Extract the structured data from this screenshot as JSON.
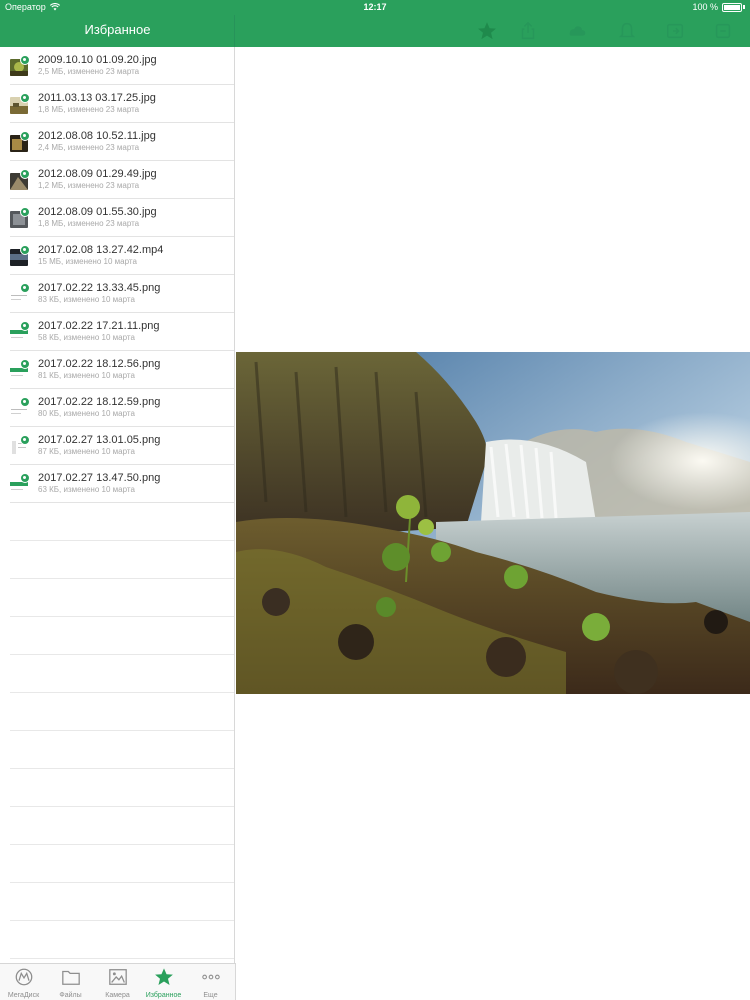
{
  "status_bar": {
    "carrier": "Оператор",
    "time": "12:17",
    "battery": "100 %"
  },
  "nav": {
    "title": "Избранное"
  },
  "toolbar": {
    "icons": [
      "star-icon",
      "share-icon",
      "link-icon",
      "delete-icon",
      "folder-move-icon",
      "more-icon"
    ]
  },
  "files": [
    {
      "name": "2009.10.10 01.09.20.jpg",
      "meta": "2,5 МБ, изменено 23 марта",
      "kind": "photo-green"
    },
    {
      "name": "2011.03.13 03.17.25.jpg",
      "meta": "1,8 МБ, изменено 23 марта",
      "kind": "photo-field"
    },
    {
      "name": "2012.08.08 10.52.11.jpg",
      "meta": "2,4 МБ, изменено 23 марта",
      "kind": "photo-dark"
    },
    {
      "name": "2012.08.09 01.29.49.jpg",
      "meta": "1,2 МБ, изменено 23 марта",
      "kind": "photo-rock"
    },
    {
      "name": "2012.08.09 01.55.30.jpg",
      "meta": "1,8 МБ, изменено 23 марта",
      "kind": "photo-grey"
    },
    {
      "name": "2017.02.08 13.27.42.mp4",
      "meta": "15 МБ, изменено 10 марта",
      "kind": "video"
    },
    {
      "name": "2017.02.22 13.33.45.png",
      "meta": "83 КБ, изменено 10 марта",
      "kind": "screen"
    },
    {
      "name": "2017.02.22 17.21.11.png",
      "meta": "58 КБ, изменено 10 марта",
      "kind": "screen-green"
    },
    {
      "name": "2017.02.22 18.12.56.png",
      "meta": "81 КБ, изменено 10 марта",
      "kind": "screen-green"
    },
    {
      "name": "2017.02.22 18.12.59.png",
      "meta": "80 КБ, изменено 10 марта",
      "kind": "screen"
    },
    {
      "name": "2017.02.27 13.01.05.png",
      "meta": "87 КБ, изменено 10 марта",
      "kind": "screen-list"
    },
    {
      "name": "2017.02.27 13.47.50.png",
      "meta": "63 КБ, изменено 10 марта",
      "kind": "screen-green"
    }
  ],
  "tabs": [
    {
      "label": "МегаДиск",
      "icon": "megadisk-icon",
      "active": false
    },
    {
      "label": "Файлы",
      "icon": "folder-icon",
      "active": false
    },
    {
      "label": "Камера",
      "icon": "image-icon",
      "active": false
    },
    {
      "label": "Избранное",
      "icon": "star-icon",
      "active": true
    },
    {
      "label": "Еще",
      "icon": "more-dots-icon",
      "active": false
    }
  ],
  "colors": {
    "accent": "#2aa05c",
    "tab_inactive": "#8e8e8e"
  }
}
